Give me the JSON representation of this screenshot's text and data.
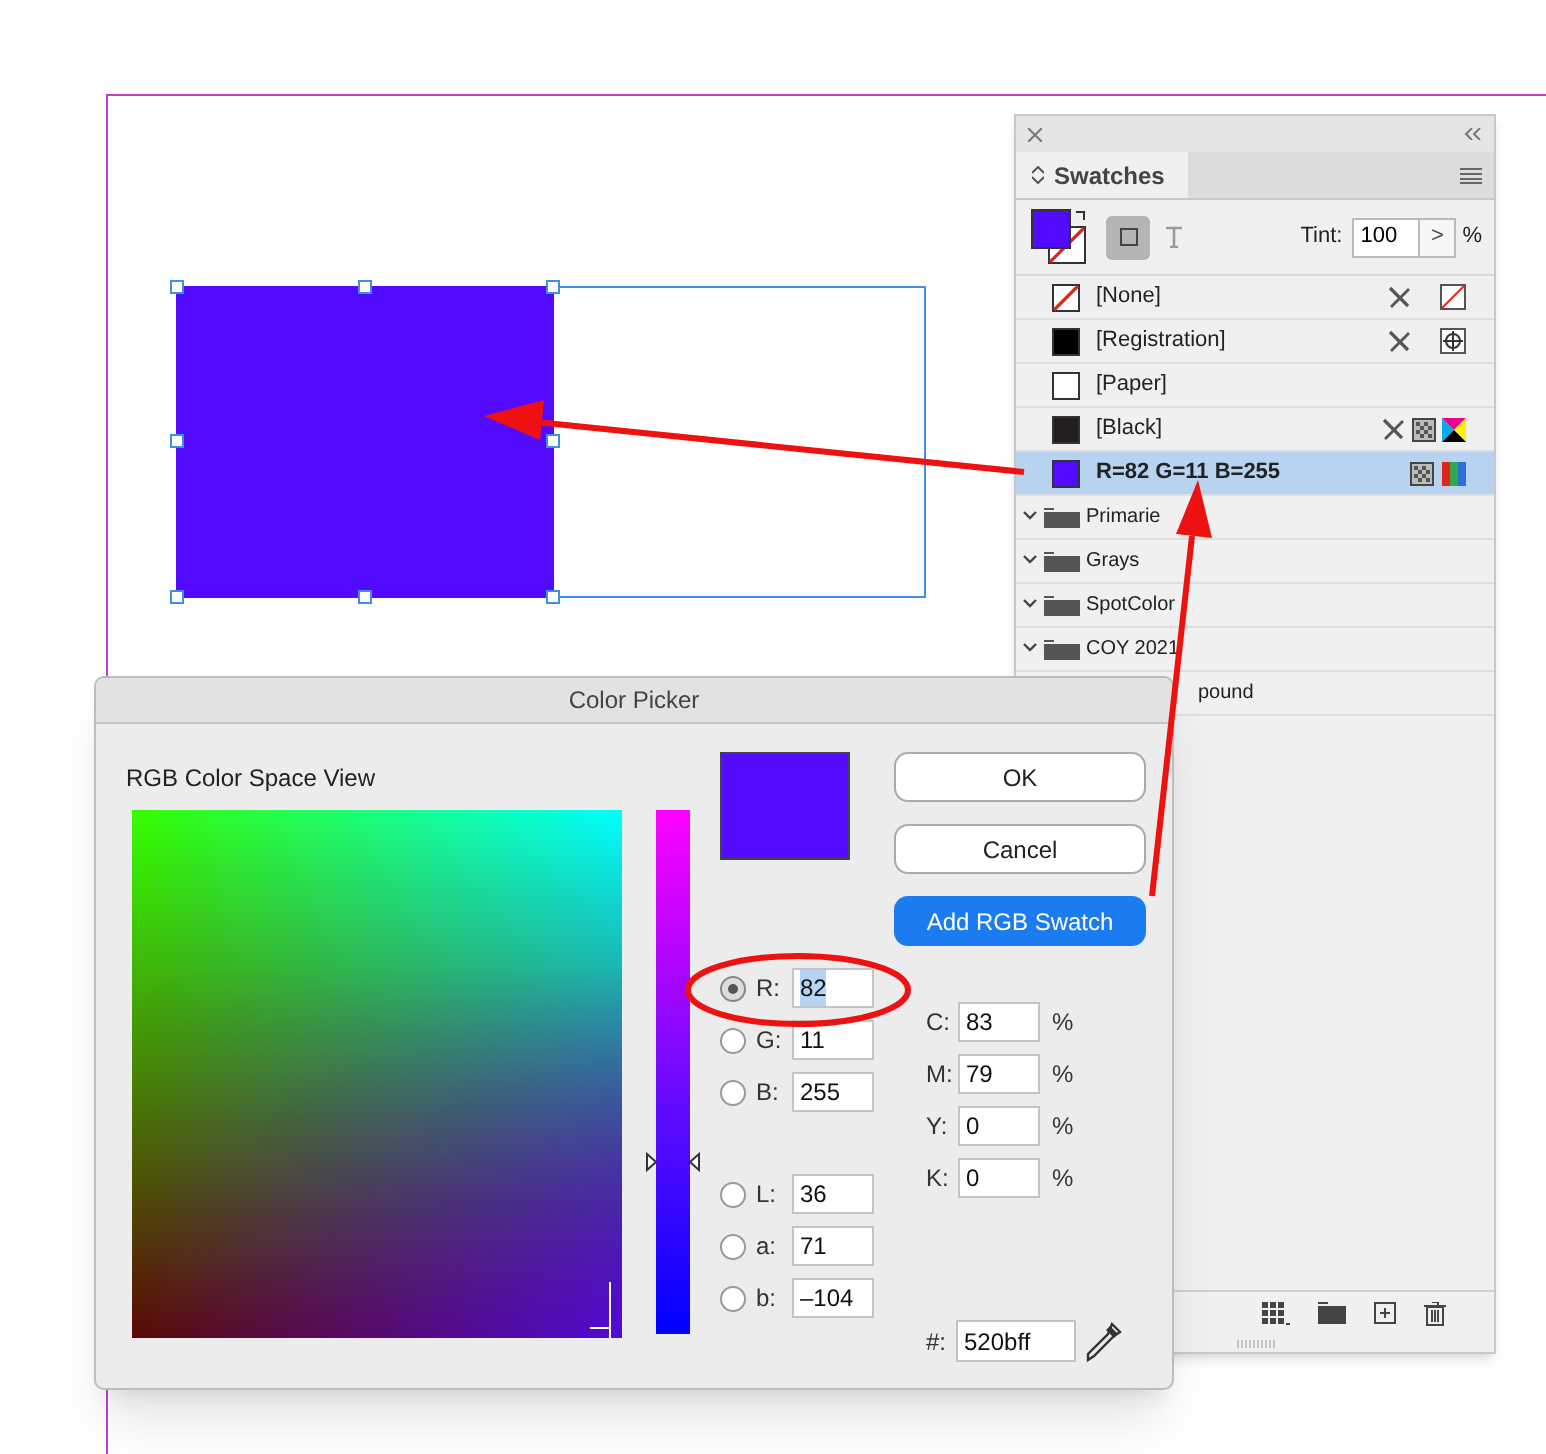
{
  "swatches_panel": {
    "tab": "Swatches",
    "tint_label": "Tint:",
    "tint_value": "100",
    "tint_step": ">",
    "tint_unit": "%",
    "swatches": [
      {
        "name": "[None]",
        "kind": "none",
        "color": "#ffffff",
        "selected": false
      },
      {
        "name": "[Registration]",
        "kind": "registration",
        "color": "#000000",
        "selected": false
      },
      {
        "name": "[Paper]",
        "kind": "paper",
        "color": "#ffffff",
        "selected": false
      },
      {
        "name": "[Black]",
        "kind": "black",
        "color": "#231f20",
        "selected": false
      },
      {
        "name": "R=82 G=11 B=255",
        "kind": "rgb",
        "color": "#520bff",
        "selected": true
      }
    ],
    "groups": [
      {
        "name": "Primarie",
        "clipped": false
      },
      {
        "name": "Grays",
        "clipped": false
      },
      {
        "name": "SpotColor",
        "clipped": false
      },
      {
        "name": "COY 2021",
        "clipped": false
      },
      {
        "name": "pound",
        "clipped": true
      }
    ]
  },
  "color_picker": {
    "title": "Color Picker",
    "view_label": "RGB Color Space View",
    "color": "#520bff",
    "buttons": [
      {
        "label": "OK",
        "kind": "plain"
      },
      {
        "label": "Cancel",
        "kind": "plain"
      },
      {
        "label": "Add RGB Swatch",
        "kind": "primary"
      }
    ],
    "rgb_fields": [
      {
        "label": "R:",
        "value": "82",
        "selected": true
      },
      {
        "label": "G:",
        "value": "11",
        "selected": false
      },
      {
        "label": "B:",
        "value": "255",
        "selected": false
      }
    ],
    "lab_fields": [
      {
        "label": "L:",
        "value": "36",
        "selected": false
      },
      {
        "label": "a:",
        "value": "71",
        "selected": false
      },
      {
        "label": "b:",
        "value": "–104",
        "selected": false
      }
    ],
    "cmyk_fields": [
      {
        "label": "C:",
        "value": "83",
        "unit": "%"
      },
      {
        "label": "M:",
        "value": "79",
        "unit": "%"
      },
      {
        "label": "Y:",
        "value": "0",
        "unit": "%"
      },
      {
        "label": "K:",
        "value": "0",
        "unit": "%"
      }
    ],
    "hex": {
      "label": "#:",
      "value": "520bff"
    }
  },
  "hue_slider": {
    "level": 0.33
  },
  "canvas": {
    "color": "#520bff"
  }
}
